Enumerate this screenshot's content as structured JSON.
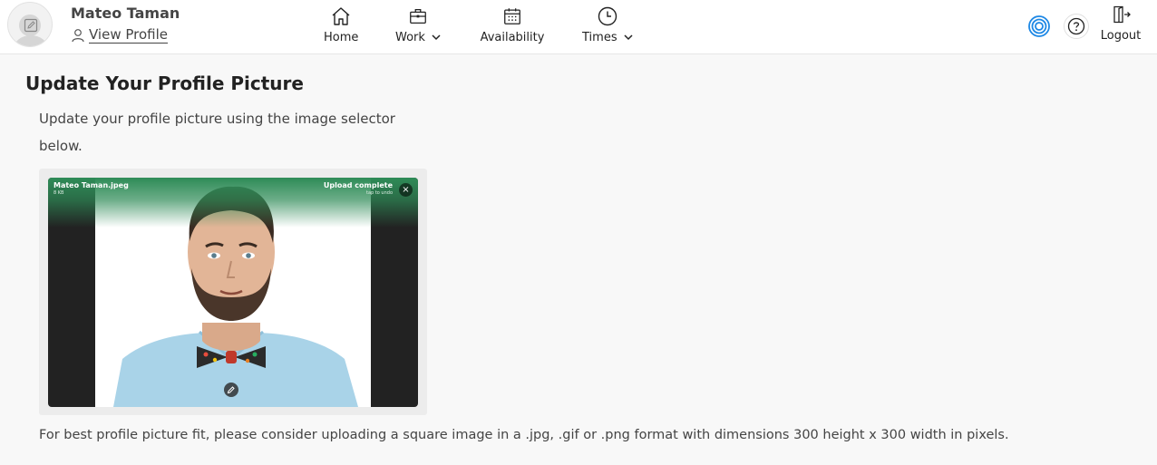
{
  "header": {
    "user_name": "Mateo Taman",
    "view_profile": "View Profile",
    "nav": [
      {
        "label": "Home",
        "icon": "home-icon",
        "has_dropdown": false
      },
      {
        "label": "Work",
        "icon": "briefcase-icon",
        "has_dropdown": true
      },
      {
        "label": "Availability",
        "icon": "calendar-icon",
        "has_dropdown": false
      },
      {
        "label": "Times",
        "icon": "clock-icon",
        "has_dropdown": true
      }
    ],
    "logout": "Logout",
    "accent_color": "#1e88e5"
  },
  "main": {
    "title": "Update Your Profile Picture",
    "description": "Update your profile picture using the image selector below.",
    "uploader": {
      "file_name": "Mateo Taman.jpeg",
      "file_size": "8 KB",
      "status": "Upload complete",
      "undo_hint": "tap to undo",
      "status_color": "#2e8b57"
    },
    "hint": "For best profile picture fit, please consider uploading a square image in a .jpg, .gif or .png format with dimensions 300 height x 300 width in pixels."
  }
}
